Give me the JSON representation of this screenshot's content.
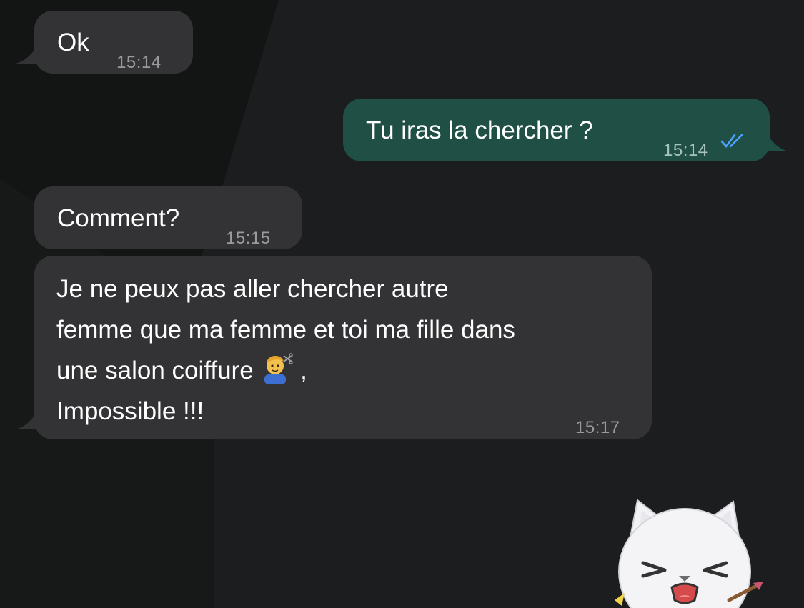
{
  "messages": [
    {
      "direction": "incoming",
      "text": "Ok",
      "time": "15:14"
    },
    {
      "direction": "outgoing",
      "text": "Tu iras la chercher ?",
      "time": "15:14",
      "status": "read",
      "status_icon": "double-check-icon"
    },
    {
      "direction": "incoming",
      "text": "Comment?",
      "time": "15:15"
    },
    {
      "direction": "incoming",
      "lines": [
        "Je ne peux pas aller chercher autre",
        "femme que ma femme et toi ma fille dans",
        "une salon coiffure",
        ",",
        "Impossible !!!"
      ],
      "emoji": "haircut-man-emoji",
      "time": "15:17"
    }
  ],
  "sticker": {
    "icon": "cat-sticker"
  },
  "colors": {
    "background": "#161616",
    "incoming_bubble": "#333335",
    "outgoing_bubble": "#1f4f45",
    "read_tick": "#4da3ff"
  }
}
